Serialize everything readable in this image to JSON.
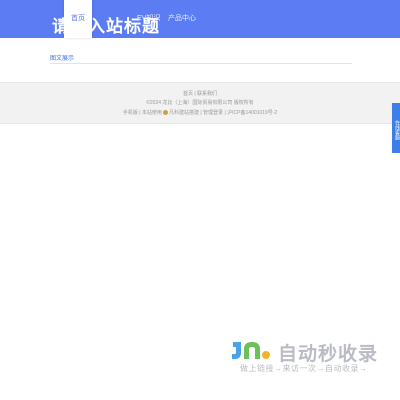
{
  "header": {
    "site_title": "请输入站标题",
    "nav": [
      {
        "label": "首页"
      },
      {
        "label": "EV知识"
      },
      {
        "label": "产品中心"
      }
    ]
  },
  "main": {
    "section_title": "图文展示"
  },
  "footer": {
    "links": [
      "首页",
      "联系我们"
    ],
    "copyright": "©2024 龙比（上海）国际贸易有限公司 版权所有",
    "row": [
      "手机版",
      "本站使用",
      "凡科建站",
      "搭建",
      "管理登录",
      "沪ICP备14001019号-2"
    ]
  },
  "side_service": {
    "label": "在线客服"
  },
  "watermark": {
    "main": "自动秒收录",
    "sub": "做上链接→来访一次→自动收录→"
  },
  "colors": {
    "header_bg": "#5b7cf2",
    "accent": "#3b6fe6",
    "footer_bg": "#f2f2f2"
  }
}
